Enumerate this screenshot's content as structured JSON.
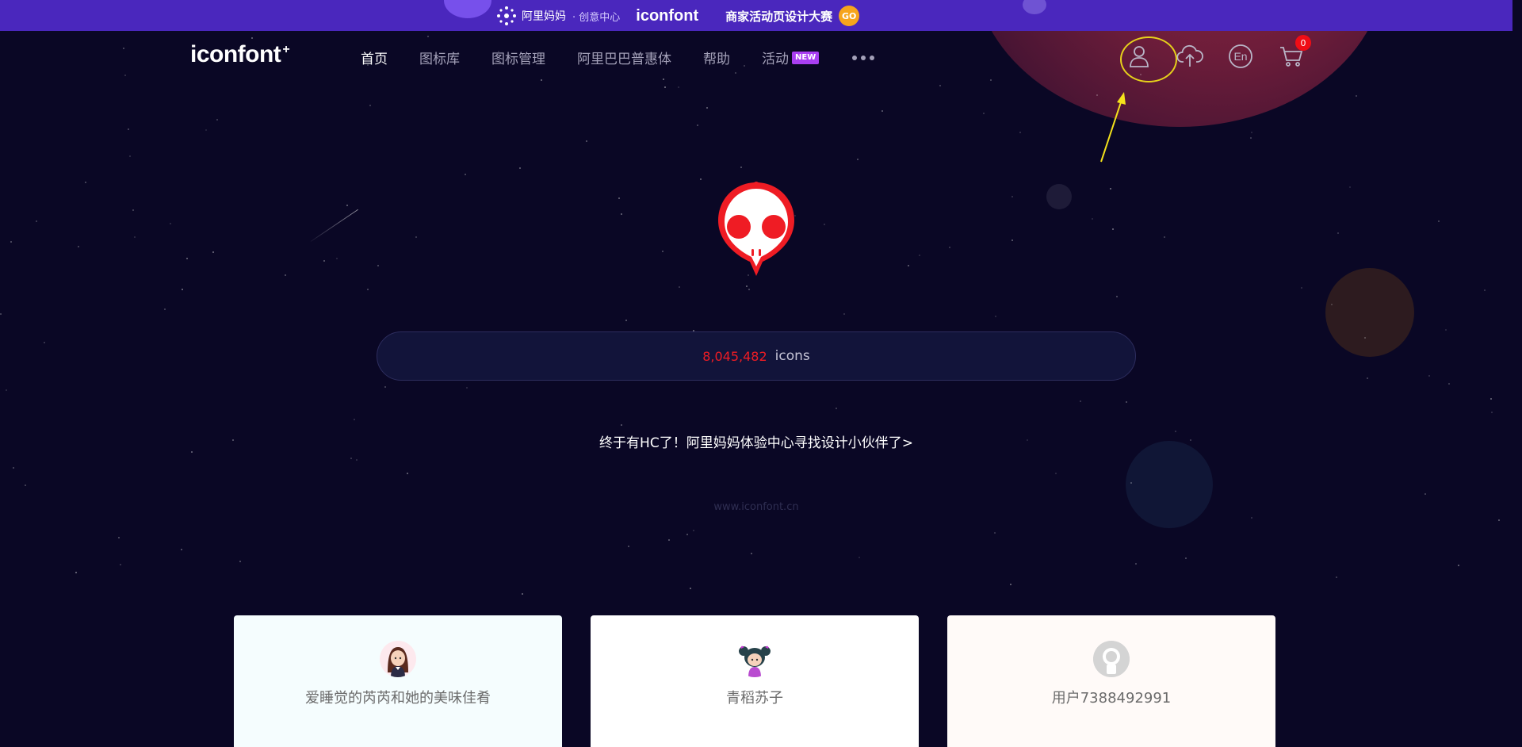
{
  "promo": {
    "brand": "阿里妈妈",
    "sub": "· 创意中心",
    "logo": "iconfont",
    "title": "商家活动页设计大赛",
    "go": "GO"
  },
  "header": {
    "logo": "iconfont",
    "logo_mark": "+",
    "nav": [
      {
        "label": "首页"
      },
      {
        "label": "图标库"
      },
      {
        "label": "图标管理"
      },
      {
        "label": "阿里巴巴普惠体"
      },
      {
        "label": "帮助"
      },
      {
        "label": "活动"
      }
    ],
    "new_badge": "NEW",
    "icons": [
      "user-icon",
      "cloud-upload-icon",
      "language-en-icon",
      "cart-icon"
    ],
    "lang_label": "En",
    "cart_count": "0"
  },
  "hero": {
    "count": "8,045,482",
    "count_unit": "icons",
    "hiring_text": "终于有HC了！阿里妈妈体验中心寻找设计小伙伴了>",
    "domain": "www.iconfont.cn"
  },
  "cards": [
    {
      "name": "爱睡觉的芮芮和她的美味佳肴",
      "bg": "#f5fdfe"
    },
    {
      "name": "青稻苏子",
      "bg": "#ffffff"
    },
    {
      "name": "用户7388492991",
      "bg": "#fffaf8"
    }
  ],
  "colors": {
    "background": "#0a0725",
    "promo": "#4a27bd",
    "count_red": "#ef1c24",
    "highlight": "#e6d11b",
    "new_badge": "#a93ff2"
  }
}
